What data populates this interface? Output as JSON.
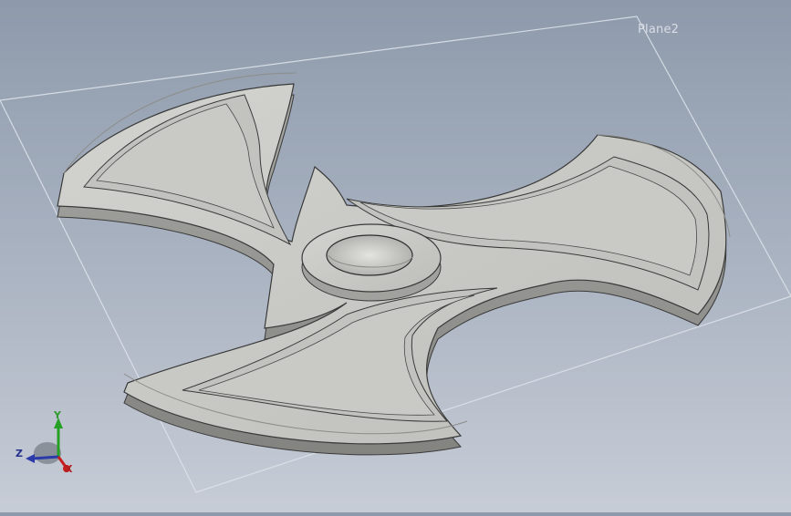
{
  "viewport": {
    "plane_label": "Plane2",
    "model": "fidget-spinner",
    "colors": {
      "background_top": "#8e9aab",
      "background_bottom": "#c7ccd6",
      "face": "#c9c9c6",
      "side": "#9b9b98",
      "edge": "#3a3a3a",
      "plane_line": "#dde2ea"
    }
  },
  "triad": {
    "y_label": "Y",
    "z_label": "Z",
    "x_label": "X",
    "colors": {
      "x": "#c41e1e",
      "y": "#25a025",
      "z": "#2a3aa8"
    }
  }
}
